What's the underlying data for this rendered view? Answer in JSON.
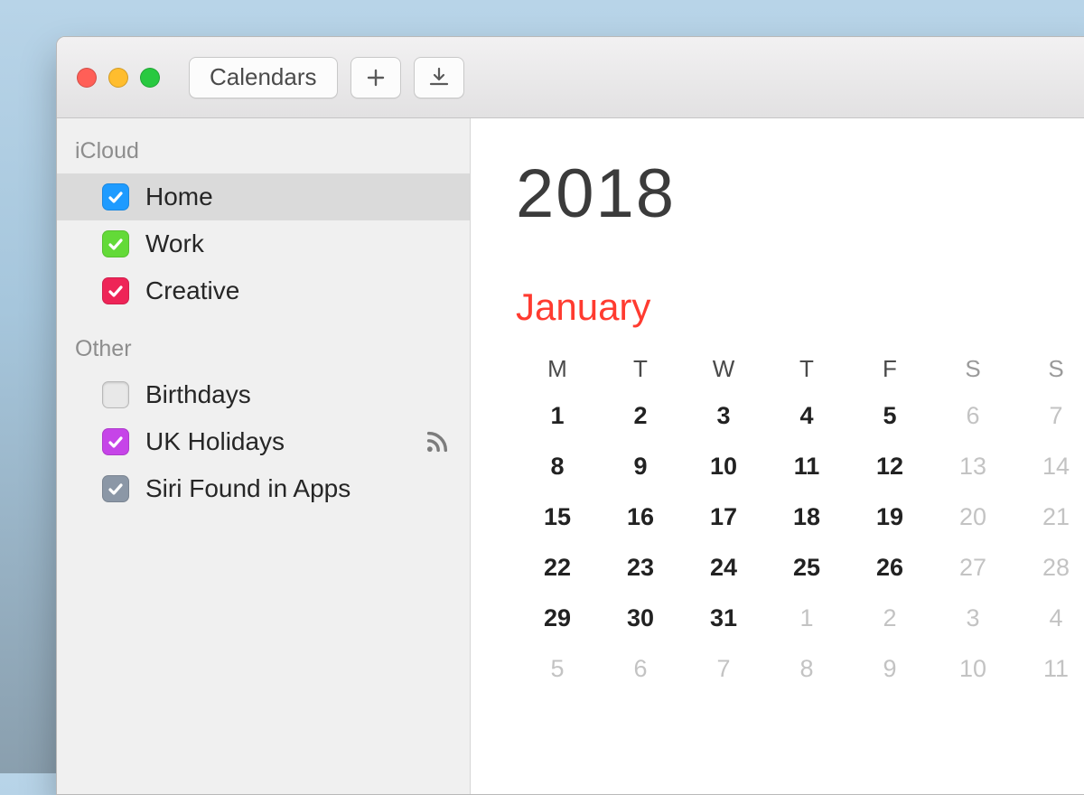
{
  "toolbar": {
    "calendars_label": "Calendars"
  },
  "sidebar": {
    "sections": [
      {
        "title": "iCloud",
        "items": [
          {
            "label": "Home",
            "color": "#1e9bff",
            "checked": true,
            "selected": true,
            "rss": false
          },
          {
            "label": "Work",
            "color": "#63da38",
            "checked": true,
            "selected": false,
            "rss": false
          },
          {
            "label": "Creative",
            "color": "#ee2457",
            "checked": true,
            "selected": false,
            "rss": false
          }
        ]
      },
      {
        "title": "Other",
        "items": [
          {
            "label": "Birthdays",
            "color": "#b8b8b8",
            "checked": false,
            "selected": false,
            "rss": false
          },
          {
            "label": "UK Holidays",
            "color": "#c644e8",
            "checked": true,
            "selected": false,
            "rss": true
          },
          {
            "label": "Siri Found in Apps",
            "color": "#8b97a6",
            "checked": true,
            "selected": false,
            "rss": false
          }
        ]
      }
    ]
  },
  "calendar": {
    "year": "2018",
    "month": "January",
    "weekday_labels": [
      "M",
      "T",
      "W",
      "T",
      "F",
      "S",
      "S"
    ],
    "weeks": [
      [
        {
          "d": "1",
          "in": true
        },
        {
          "d": "2",
          "in": true
        },
        {
          "d": "3",
          "in": true
        },
        {
          "d": "4",
          "in": true
        },
        {
          "d": "5",
          "in": true
        },
        {
          "d": "6",
          "in": false
        },
        {
          "d": "7",
          "in": false
        }
      ],
      [
        {
          "d": "8",
          "in": true
        },
        {
          "d": "9",
          "in": true
        },
        {
          "d": "10",
          "in": true
        },
        {
          "d": "11",
          "in": true
        },
        {
          "d": "12",
          "in": true
        },
        {
          "d": "13",
          "in": false
        },
        {
          "d": "14",
          "in": false
        }
      ],
      [
        {
          "d": "15",
          "in": true
        },
        {
          "d": "16",
          "in": true
        },
        {
          "d": "17",
          "in": true
        },
        {
          "d": "18",
          "in": true
        },
        {
          "d": "19",
          "in": true
        },
        {
          "d": "20",
          "in": false
        },
        {
          "d": "21",
          "in": false
        }
      ],
      [
        {
          "d": "22",
          "in": true
        },
        {
          "d": "23",
          "in": true
        },
        {
          "d": "24",
          "in": true
        },
        {
          "d": "25",
          "in": true
        },
        {
          "d": "26",
          "in": true
        },
        {
          "d": "27",
          "in": false
        },
        {
          "d": "28",
          "in": false
        }
      ],
      [
        {
          "d": "29",
          "in": true
        },
        {
          "d": "30",
          "in": true
        },
        {
          "d": "31",
          "in": true
        },
        {
          "d": "1",
          "in": false
        },
        {
          "d": "2",
          "in": false
        },
        {
          "d": "3",
          "in": false
        },
        {
          "d": "4",
          "in": false
        }
      ],
      [
        {
          "d": "5",
          "in": false
        },
        {
          "d": "6",
          "in": false
        },
        {
          "d": "7",
          "in": false
        },
        {
          "d": "8",
          "in": false
        },
        {
          "d": "9",
          "in": false
        },
        {
          "d": "10",
          "in": false
        },
        {
          "d": "11",
          "in": false
        }
      ]
    ]
  }
}
